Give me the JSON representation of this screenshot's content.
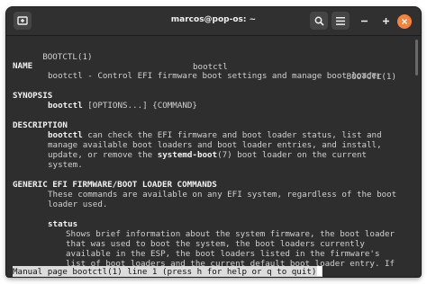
{
  "window": {
    "title": "marcos@pop-os: ~",
    "buttons": {
      "new_tab": "new-tab-icon",
      "search": "search-icon",
      "menu": "hamburger-menu-icon",
      "minimize": "minimize-icon",
      "maximize": "maximize-icon",
      "close": "close-icon"
    },
    "close_color": "#f6823b"
  },
  "man": {
    "header_left": "BOOTCTL(1)",
    "header_center": "bootctl",
    "header_right": "BOOTCTL(1)",
    "name_heading": "NAME",
    "name_line": "bootctl - Control EFI firmware boot settings and manage boot loader",
    "synopsis_heading": "SYNOPSIS",
    "synopsis_cmd": "bootctl",
    "synopsis_args": " [OPTIONS...] {COMMAND}",
    "description_heading": "DESCRIPTION",
    "desc_l1_cmd": "bootctl",
    "desc_l1_rest": " can check the EFI firmware and boot loader status, list and",
    "desc_l2": "manage available boot loaders and boot loader entries, and install,",
    "desc_l3_pre": "update, or remove the ",
    "desc_l3_bold": "systemd-boot",
    "desc_l3_post": "(7) boot loader on the current",
    "desc_l4": "system.",
    "generic_heading": "GENERIC EFI FIRMWARE/BOOT LOADER COMMANDS",
    "generic_l1": "These commands are available on any EFI system, regardless of the boot",
    "generic_l2": "loader used.",
    "status_cmd": "status",
    "status_l1": "Shows brief information about the system firmware, the boot loader",
    "status_l2": "that was used to boot the system, the boot loaders currently",
    "status_l3": "available in the ESP, the boot loaders listed in the firmware's",
    "status_l4": "list of boot loaders and the current default boot loader entry. If",
    "status_bar": "Manual page bootctl(1) line 1 (press h for help or q to quit)"
  }
}
